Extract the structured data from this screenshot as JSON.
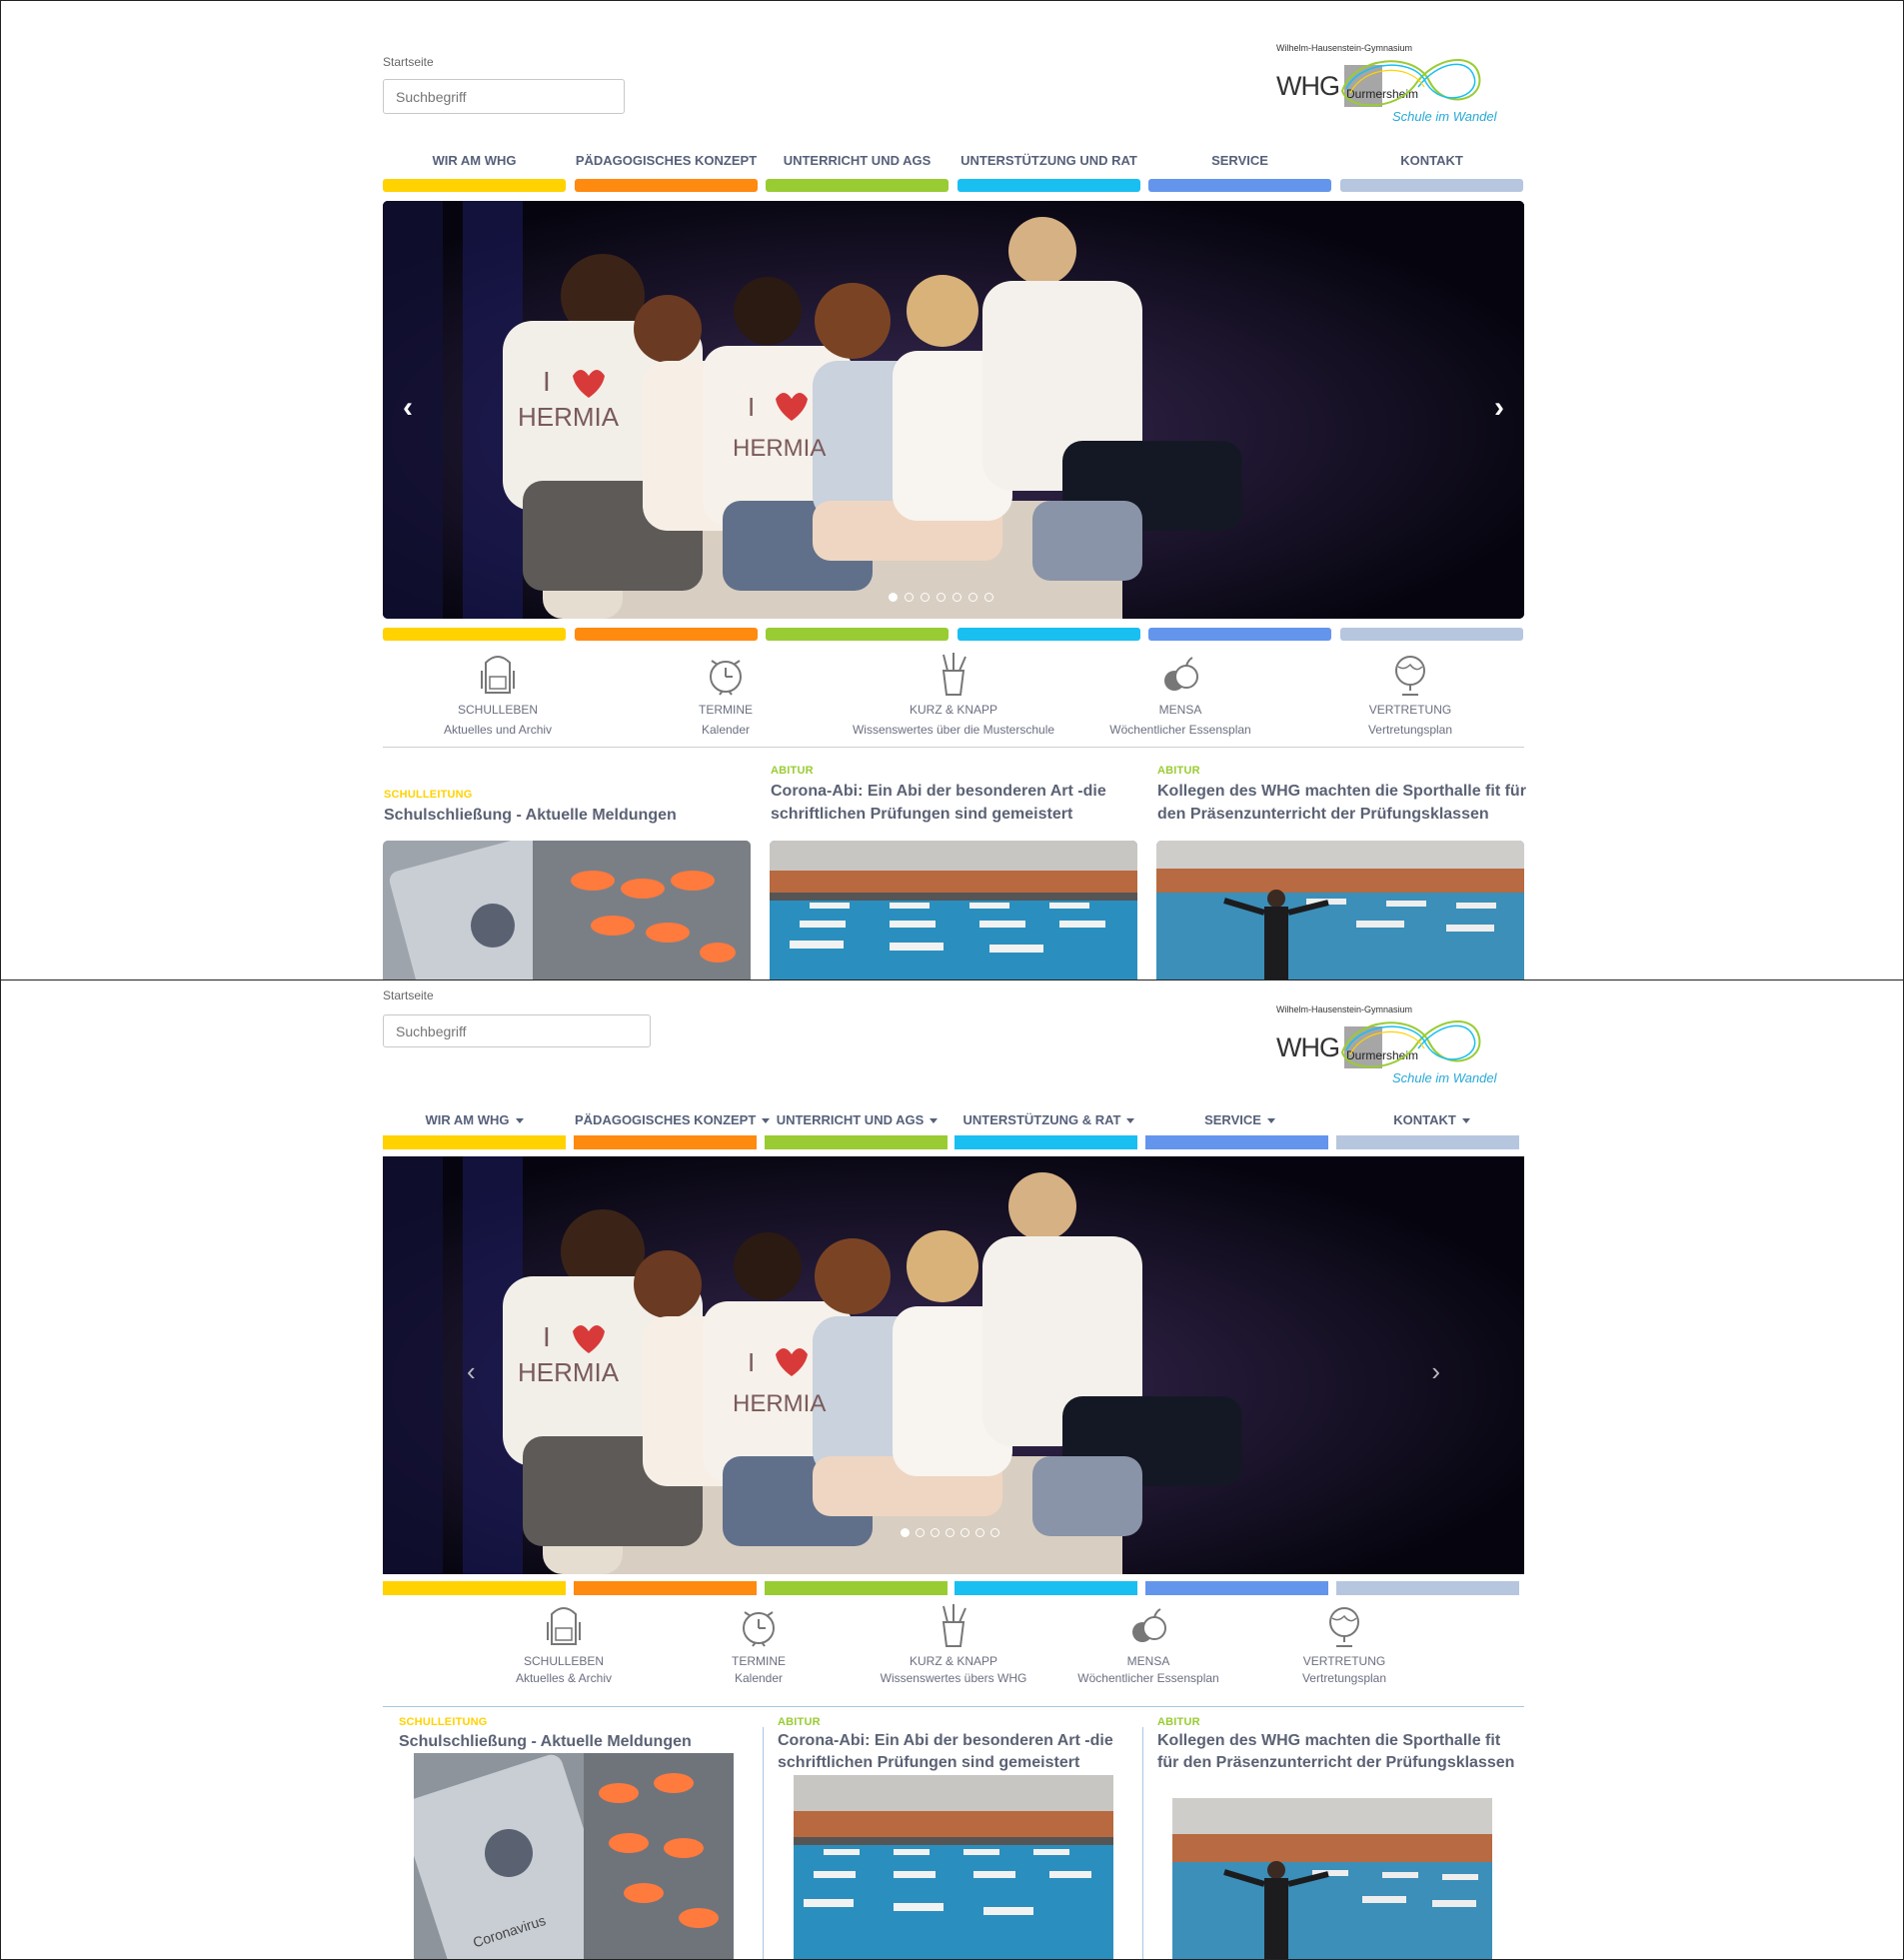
{
  "breadcrumb": "Startseite",
  "search": {
    "placeholder": "Suchbegriff"
  },
  "logo": {
    "caption": "Wilhelm-Hausenstein-Gymnasium",
    "whg": "WHG",
    "town": "Durmersheim",
    "slogan": "Schule im Wandel"
  },
  "colors": {
    "yellow": "#ffd200",
    "orange": "#ff8a10",
    "green": "#99cc33",
    "cyan": "#19bff0",
    "blue": "#6495ed",
    "grey_blue": "#b6c6df"
  },
  "nav_a": [
    {
      "label": "WIR AM WHG"
    },
    {
      "label": "PÄDAGOGISCHES KONZEPT"
    },
    {
      "label": "UNTERRICHT UND AGS"
    },
    {
      "label": "UNTERSTÜTZUNG UND RAT"
    },
    {
      "label": "SERVICE"
    },
    {
      "label": "KONTAKT"
    }
  ],
  "nav_b": [
    {
      "label": "WIR AM WHG"
    },
    {
      "label": "PÄDAGOGISCHES KONZEPT"
    },
    {
      "label": "UNTERRICHT UND AGS"
    },
    {
      "label": "UNTERSTÜTZUNG & RAT"
    },
    {
      "label": "SERVICE"
    },
    {
      "label": "KONTAKT"
    }
  ],
  "slider": {
    "prev": "‹",
    "next": "›",
    "slide_count": 7,
    "active_index": 0,
    "shirt_text_1": "I",
    "shirt_text_2": "HERMIA"
  },
  "quicklinks_a": [
    {
      "icon": "backpack-icon",
      "title": "SCHULLEBEN",
      "sub": "Aktuelles und Archiv"
    },
    {
      "icon": "alarm-clock-icon",
      "title": "TERMINE",
      "sub": "Kalender"
    },
    {
      "icon": "pencil-cup-icon",
      "title": "KURZ & KNAPP",
      "sub": "Wissenswertes über die Musterschule"
    },
    {
      "icon": "apples-icon",
      "title": "MENSA",
      "sub": "Wöchentlicher Essensplan"
    },
    {
      "icon": "globe-icon",
      "title": "VERTRETUNG",
      "sub": "Vertretungsplan"
    }
  ],
  "quicklinks_b": [
    {
      "icon": "backpack-icon",
      "title": "SCHULLEBEN",
      "sub": "Aktuelles & Archiv"
    },
    {
      "icon": "alarm-clock-icon",
      "title": "TERMINE",
      "sub": "Kalender"
    },
    {
      "icon": "pencil-cup-icon",
      "title": "KURZ & KNAPP",
      "sub": "Wissenswertes übers WHG"
    },
    {
      "icon": "apples-icon",
      "title": "MENSA",
      "sub": "Wöchentlicher Essensplan"
    },
    {
      "icon": "globe-icon",
      "title": "VERTRETUNG",
      "sub": "Vertretungsplan"
    }
  ],
  "news": [
    {
      "category": "SCHULLEITUNG",
      "category_color": "#ffd200",
      "title": "Schulschließung - Aktuelle Meldungen",
      "image": "coronavirus-phone-pills",
      "image_text": "Coronavirus"
    },
    {
      "category": "ABITUR",
      "category_color": "#99cc33",
      "title": "Corona-Abi: Ein Abi der besonderen Art -die schriftlichen Prüfungen sind gemeistert",
      "image": "sports-hall-exam-desks"
    },
    {
      "category": "ABITUR",
      "category_color": "#99cc33",
      "title": "Kollegen des WHG machten die Sporthalle fit für den Präsenzunterricht der Prüfungsklassen",
      "image": "sports-hall-teacher"
    }
  ]
}
